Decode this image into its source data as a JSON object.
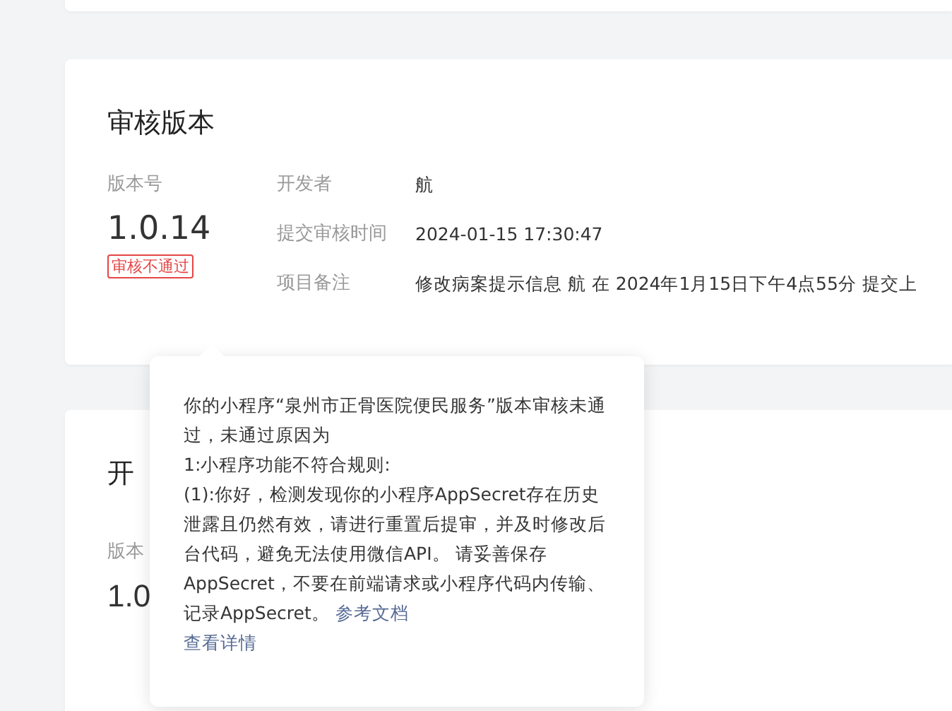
{
  "review_card": {
    "title": "审核版本",
    "version_label": "版本号",
    "version": "1.0.14",
    "status": {
      "label": "审核不通过",
      "kind": "rejected"
    },
    "details": [
      {
        "label": "开发者",
        "value": "航"
      },
      {
        "label": "提交审核时间",
        "value": "2024-01-15 17:30:47"
      },
      {
        "label": "项目备注",
        "value": "修改病案提示信息 航 在 2024年1月15日下午4点55分 提交上"
      }
    ]
  },
  "dev_card": {
    "title": "开",
    "version_label": "版本",
    "version": "1.0"
  },
  "popover": {
    "paragraphs": [
      "你的小程序“泉州市正骨医院便民服务”版本审核未通过，未通过原因为",
      "1:小程序功能不符合规则:",
      "(1):你好，检测发现你的小程序AppSecret存在历史泄露且仍然有效，请进行重置后提审，并及时修改后台代码，避免无法使用微信API。 请妥善保存AppSecret，不要在前端请求或小程序代码内传输、记录AppSecret。"
    ],
    "doc_link": "参考文档",
    "details_link": "查看详情"
  }
}
